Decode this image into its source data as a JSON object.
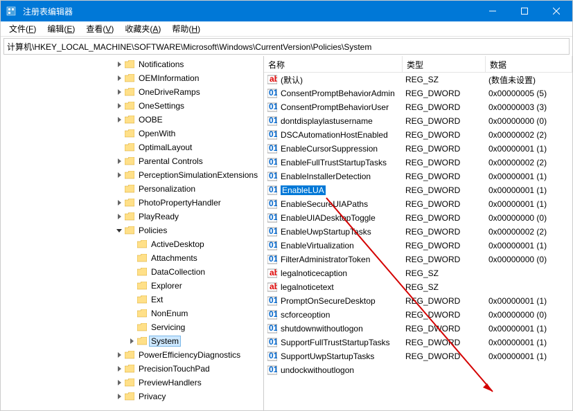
{
  "window": {
    "title": "注册表编辑器"
  },
  "menubar": [
    {
      "label": "文件",
      "acc": "F"
    },
    {
      "label": "编辑",
      "acc": "E"
    },
    {
      "label": "查看",
      "acc": "V"
    },
    {
      "label": "收藏夹",
      "acc": "A"
    },
    {
      "label": "帮助",
      "acc": "H"
    }
  ],
  "address": "计算机\\HKEY_LOCAL_MACHINE\\SOFTWARE\\Microsoft\\Windows\\CurrentVersion\\Policies\\System",
  "tree": [
    {
      "depth": 3,
      "exp": "right",
      "label": "Notifications"
    },
    {
      "depth": 3,
      "exp": "right",
      "label": "OEMInformation"
    },
    {
      "depth": 3,
      "exp": "right",
      "label": "OneDriveRamps"
    },
    {
      "depth": 3,
      "exp": "right",
      "label": "OneSettings"
    },
    {
      "depth": 3,
      "exp": "right",
      "label": "OOBE"
    },
    {
      "depth": 3,
      "exp": "none",
      "label": "OpenWith"
    },
    {
      "depth": 3,
      "exp": "none",
      "label": "OptimalLayout"
    },
    {
      "depth": 3,
      "exp": "right",
      "label": "Parental Controls"
    },
    {
      "depth": 3,
      "exp": "right",
      "label": "PerceptionSimulationExtensions"
    },
    {
      "depth": 3,
      "exp": "none",
      "label": "Personalization"
    },
    {
      "depth": 3,
      "exp": "right",
      "label": "PhotoPropertyHandler"
    },
    {
      "depth": 3,
      "exp": "right",
      "label": "PlayReady"
    },
    {
      "depth": 3,
      "exp": "down",
      "label": "Policies"
    },
    {
      "depth": 4,
      "exp": "none",
      "label": "ActiveDesktop"
    },
    {
      "depth": 4,
      "exp": "none",
      "label": "Attachments"
    },
    {
      "depth": 4,
      "exp": "none",
      "label": "DataCollection"
    },
    {
      "depth": 4,
      "exp": "none",
      "label": "Explorer"
    },
    {
      "depth": 4,
      "exp": "none",
      "label": "Ext"
    },
    {
      "depth": 4,
      "exp": "none",
      "label": "NonEnum"
    },
    {
      "depth": 4,
      "exp": "none",
      "label": "Servicing"
    },
    {
      "depth": 4,
      "exp": "right",
      "label": "System",
      "selected": true
    },
    {
      "depth": 3,
      "exp": "right",
      "label": "PowerEfficiencyDiagnostics"
    },
    {
      "depth": 3,
      "exp": "right",
      "label": "PrecisionTouchPad"
    },
    {
      "depth": 3,
      "exp": "right",
      "label": "PreviewHandlers"
    },
    {
      "depth": 3,
      "exp": "right",
      "label": "Privacy"
    }
  ],
  "columns": {
    "name": "名称",
    "type": "类型",
    "data": "数据"
  },
  "values": [
    {
      "icon": "sz",
      "name": "(默认)",
      "type": "REG_SZ",
      "data": "(数值未设置)"
    },
    {
      "icon": "dw",
      "name": "ConsentPromptBehaviorAdmin",
      "type": "REG_DWORD",
      "data": "0x00000005 (5)"
    },
    {
      "icon": "dw",
      "name": "ConsentPromptBehaviorUser",
      "type": "REG_DWORD",
      "data": "0x00000003 (3)"
    },
    {
      "icon": "dw",
      "name": "dontdisplaylastusername",
      "type": "REG_DWORD",
      "data": "0x00000000 (0)"
    },
    {
      "icon": "dw",
      "name": "DSCAutomationHostEnabled",
      "type": "REG_DWORD",
      "data": "0x00000002 (2)"
    },
    {
      "icon": "dw",
      "name": "EnableCursorSuppression",
      "type": "REG_DWORD",
      "data": "0x00000001 (1)"
    },
    {
      "icon": "dw",
      "name": "EnableFullTrustStartupTasks",
      "type": "REG_DWORD",
      "data": "0x00000002 (2)"
    },
    {
      "icon": "dw",
      "name": "EnableInstallerDetection",
      "type": "REG_DWORD",
      "data": "0x00000001 (1)"
    },
    {
      "icon": "dw",
      "name": "EnableLUA",
      "type": "REG_DWORD",
      "data": "0x00000001 (1)",
      "highlight": true
    },
    {
      "icon": "dw",
      "name": "EnableSecureUIAPaths",
      "type": "REG_DWORD",
      "data": "0x00000001 (1)"
    },
    {
      "icon": "dw",
      "name": "EnableUIADesktopToggle",
      "type": "REG_DWORD",
      "data": "0x00000000 (0)"
    },
    {
      "icon": "dw",
      "name": "EnableUwpStartupTasks",
      "type": "REG_DWORD",
      "data": "0x00000002 (2)"
    },
    {
      "icon": "dw",
      "name": "EnableVirtualization",
      "type": "REG_DWORD",
      "data": "0x00000001 (1)"
    },
    {
      "icon": "dw",
      "name": "FilterAdministratorToken",
      "type": "REG_DWORD",
      "data": "0x00000000 (0)"
    },
    {
      "icon": "sz",
      "name": "legalnoticecaption",
      "type": "REG_SZ",
      "data": ""
    },
    {
      "icon": "sz",
      "name": "legalnoticetext",
      "type": "REG_SZ",
      "data": ""
    },
    {
      "icon": "dw",
      "name": "PromptOnSecureDesktop",
      "type": "REG_DWORD",
      "data": "0x00000001 (1)"
    },
    {
      "icon": "dw",
      "name": "scforceoption",
      "type": "REG_DWORD",
      "data": "0x00000000 (0)"
    },
    {
      "icon": "dw",
      "name": "shutdownwithoutlogon",
      "type": "REG_DWORD",
      "data": "0x00000001 (1)"
    },
    {
      "icon": "dw",
      "name": "SupportFullTrustStartupTasks",
      "type": "REG_DWORD",
      "data": "0x00000001 (1)"
    },
    {
      "icon": "dw",
      "name": "SupportUwpStartupTasks",
      "type": "REG_DWORD",
      "data": "0x00000001 (1)"
    },
    {
      "icon": "dw",
      "name": "undockwithoutlogon",
      "type": "",
      "data": ""
    }
  ]
}
